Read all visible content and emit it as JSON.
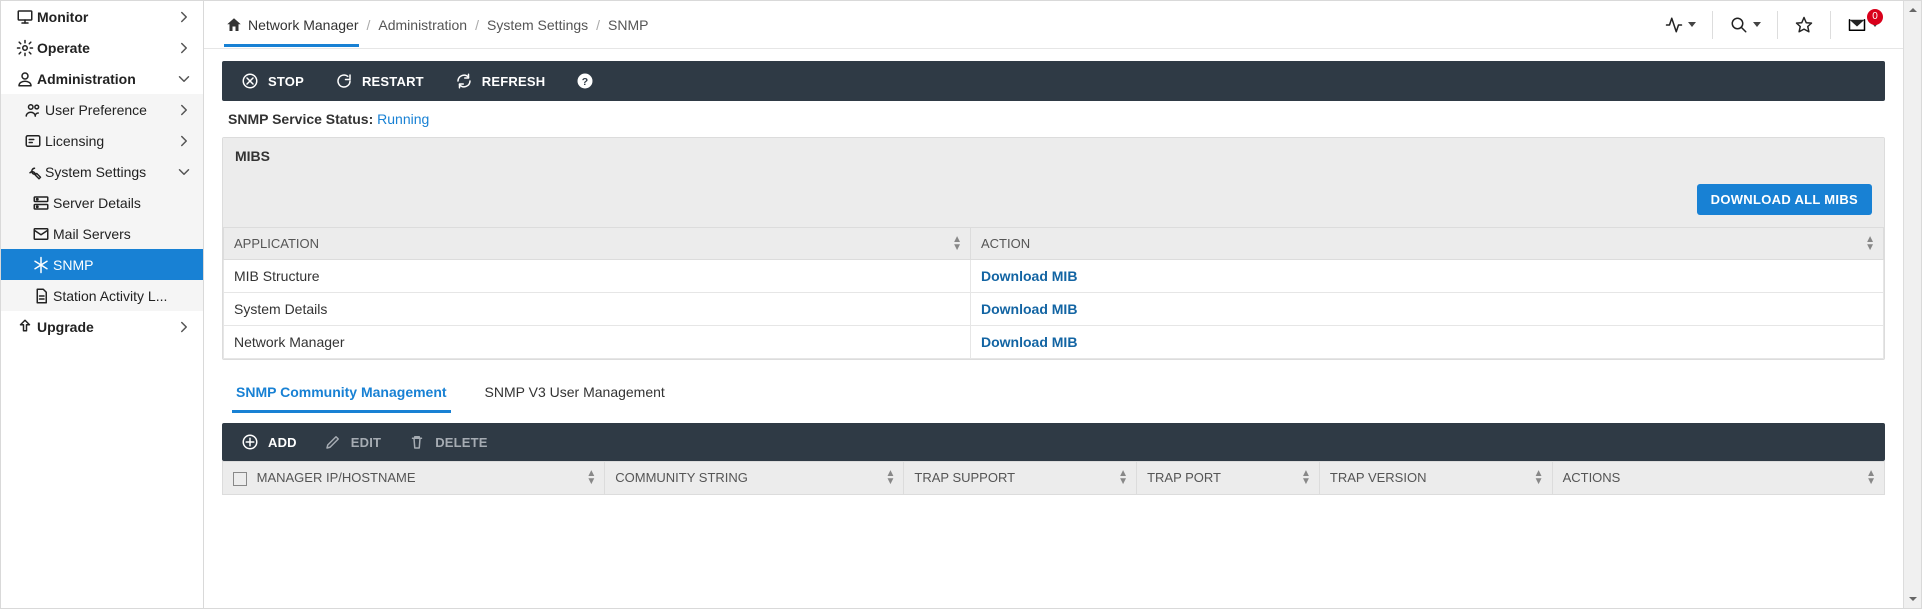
{
  "sidebar": {
    "items": [
      {
        "id": "monitor",
        "label": "Monitor",
        "level": 1,
        "chev": "right",
        "icon": "monitor"
      },
      {
        "id": "operate",
        "label": "Operate",
        "level": 1,
        "chev": "right",
        "icon": "gear"
      },
      {
        "id": "administration",
        "label": "Administration",
        "level": 1,
        "chev": "down",
        "icon": "user"
      },
      {
        "id": "user-pref",
        "label": "User Preference",
        "level": 2,
        "chev": "right",
        "icon": "users"
      },
      {
        "id": "licensing",
        "label": "Licensing",
        "level": 2,
        "chev": "right",
        "icon": "license"
      },
      {
        "id": "sys-settings",
        "label": "System Settings",
        "level": 2,
        "chev": "down",
        "icon": "wrench"
      },
      {
        "id": "server-details",
        "label": "Server Details",
        "level": 3,
        "chev": "",
        "icon": "server"
      },
      {
        "id": "mail-servers",
        "label": "Mail Servers",
        "level": 3,
        "chev": "",
        "icon": "mail"
      },
      {
        "id": "snmp",
        "label": "SNMP",
        "level": 3,
        "chev": "",
        "icon": "snow",
        "selected": true
      },
      {
        "id": "station-log",
        "label": "Station Activity L...",
        "level": 3,
        "chev": "",
        "icon": "doc"
      },
      {
        "id": "upgrade",
        "label": "Upgrade",
        "level": 1,
        "chev": "right",
        "icon": "upload"
      }
    ]
  },
  "breadcrumb": {
    "home": "Network Manager",
    "items": [
      "Administration",
      "System Settings",
      "SNMP"
    ]
  },
  "top": {
    "notification_count": "0"
  },
  "toolbar": {
    "stop": "STOP",
    "restart": "RESTART",
    "refresh": "REFRESH"
  },
  "status": {
    "label": "SNMP Service Status:",
    "value": "Running"
  },
  "mibs": {
    "title": "MIBS",
    "download_all": "DOWNLOAD ALL MIBS",
    "headers": {
      "app": "APPLICATION",
      "action": "ACTION"
    },
    "rows": [
      {
        "app": "MIB Structure",
        "action": "Download MIB"
      },
      {
        "app": "System Details",
        "action": "Download MIB"
      },
      {
        "app": "Network Manager",
        "action": "Download MIB"
      }
    ]
  },
  "tabs": {
    "community": "SNMP Community Management",
    "v3": "SNMP V3 User Management"
  },
  "mgr_toolbar": {
    "add": "ADD",
    "edit": "EDIT",
    "delete": "DELETE"
  },
  "mgr_headers": {
    "ip": "MANAGER IP/HOSTNAME",
    "community": "COMMUNITY STRING",
    "trap_support": "TRAP SUPPORT",
    "trap_port": "TRAP PORT",
    "trap_version": "TRAP VERSION",
    "actions": "ACTIONS"
  }
}
